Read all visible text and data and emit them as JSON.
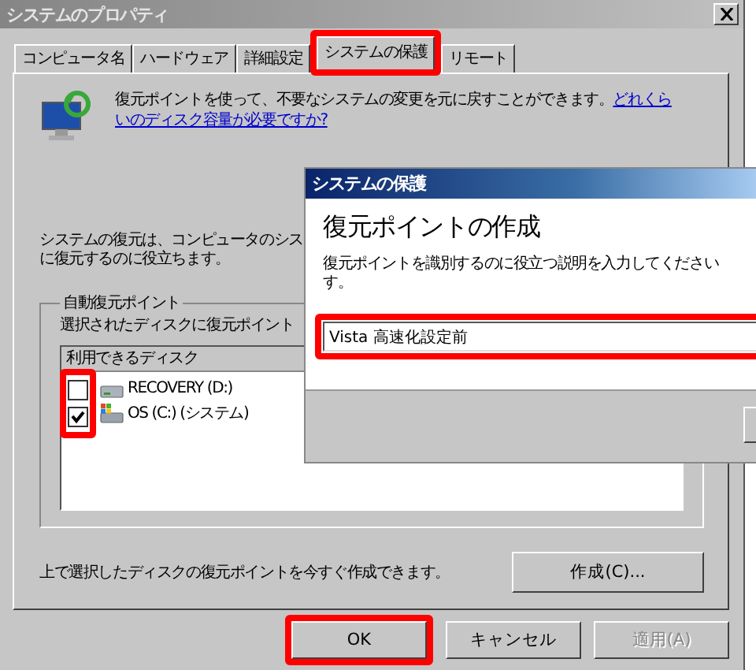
{
  "window": {
    "title": "システムのプロパティ"
  },
  "tabs": [
    {
      "label": "コンピュータ名",
      "selected": false,
      "highlighted": false
    },
    {
      "label": "ハードウェア",
      "selected": false,
      "highlighted": false
    },
    {
      "label": "詳細設定",
      "selected": false,
      "highlighted": false
    },
    {
      "label": "システムの保護",
      "selected": true,
      "highlighted": true
    },
    {
      "label": "リモート",
      "selected": false,
      "highlighted": false
    }
  ],
  "intro": {
    "text": "復元ポイントを使って、不要なシステムの変更を元に戻すことができます。",
    "link": [
      "どれくら",
      "いのディスク容量が必要ですか?"
    ]
  },
  "restore_description": [
    "システムの復元は、コンピュータのシス",
    "に復元するのに役立ちます。"
  ],
  "auto_restore": {
    "title": "自動復元ポイント",
    "hint": "選択されたディスクに復元ポイント",
    "list_header": "利用できるディスク",
    "checkboxes_highlighted": true,
    "disks": [
      {
        "name": "RECOVERY (D:)",
        "kind": "drive",
        "checked": false
      },
      {
        "name": "OS (C:) (システム)",
        "kind": "system",
        "checked": true
      }
    ]
  },
  "create": {
    "text": "上で選択したディスクの復元ポイントを今すぐ作成できます。",
    "button": "作成(C)..."
  },
  "buttons": [
    {
      "label": "OK",
      "disabled": false,
      "highlighted": true
    },
    {
      "label": "キャンセル",
      "disabled": false,
      "highlighted": false
    },
    {
      "label": "適用(A)",
      "disabled": true,
      "highlighted": false
    }
  ],
  "dialog": {
    "title": "システムの保護",
    "heading": "復元ポイントの作成",
    "instruction": [
      "復元ポイントを識別するのに役立つ説明を入力してください",
      "す。"
    ],
    "field": {
      "value": "Vista 高速化設定前",
      "highlighted": true
    }
  }
}
